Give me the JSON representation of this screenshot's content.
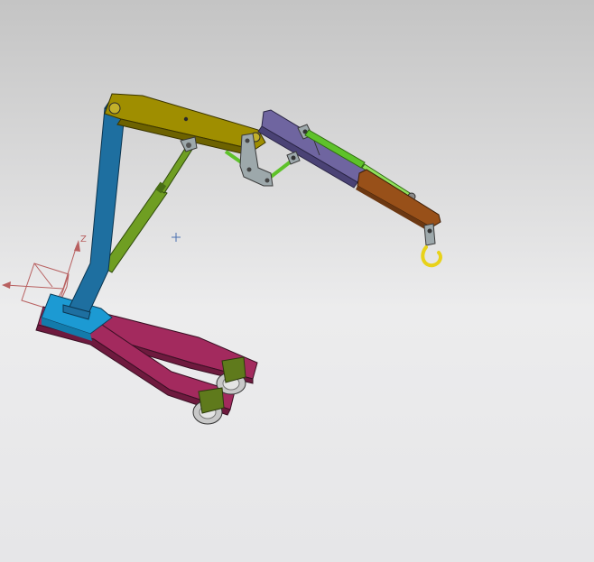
{
  "viewport": {
    "background_top": "#c4c4c4",
    "background_bottom": "#ececed",
    "triad_axis_label_z": "Z"
  },
  "colors": {
    "mast": "#1e6fa0",
    "mast_dark": "#0f4f78",
    "base_block": "#1c9ad3",
    "legs": "#a32a5e",
    "legs_dark": "#6e1a3e",
    "wheel_bracket": "#5f7a1c",
    "wheel": "#c8c8c8",
    "upper_boom": "#9f8e00",
    "upper_boom_dark": "#6d6200",
    "outer_boom": "#6f65a0",
    "outer_boom_dark": "#4a4275",
    "extension": "#985019",
    "main_cylinder": "#6f9e22",
    "link_rod": "#5ec22a",
    "bracket": "#9da8ab",
    "hook": "#e8d21a",
    "triad": "#b86060"
  },
  "icons": {
    "view_center": "crosshair-icon",
    "coordinate_triad": "axis-triad-icon"
  }
}
